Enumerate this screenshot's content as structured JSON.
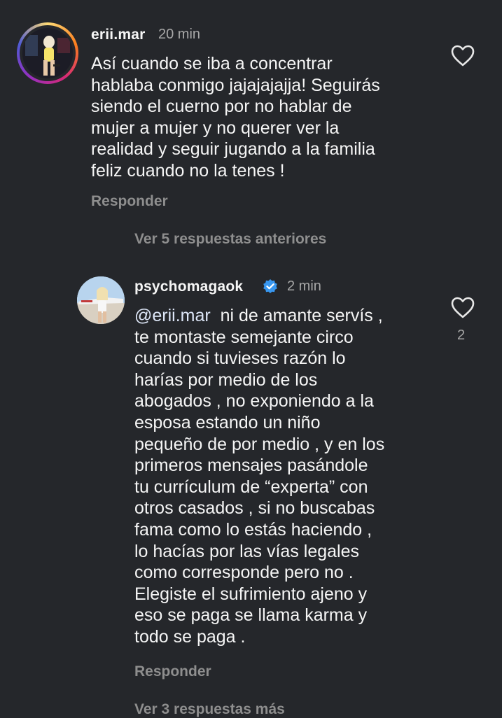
{
  "comment1": {
    "username": "erii.mar",
    "time": "20 min",
    "text": "Así cuando se iba a concentrar\nhablaba conmigo jajajajajja! Seguirás\nsiendo el cuerno por no hablar de\nmujer a mujer y no querer ver la\nrealidad y seguir jugando a la familia\nfeliz cuando no la tenes !",
    "reply_label": "Responder",
    "like_icon": "heart-outline-icon"
  },
  "view_previous_label": "Ver 5 respuestas anteriores",
  "comment2": {
    "username": "psychomagaok",
    "verified_icon": "verified-badge-icon",
    "time": "2 min",
    "mention": "@erii.mar",
    "text": "ni de amante servís ,\nte montaste semejante circo\ncuando si tuvieses razón lo\nharías por medio de los\nabogados , no exponiendo a la\nesposa estando un niño\npequeño de por medio , y en los\nprimeros mensajes pasándole\ntu currículum de “experta” con\notros casados , si no buscabas\nfama como lo estás haciendo ,\nlo hacías por las vías legales\ncomo corresponde pero no .\nElegiste el sufrimiento ajeno y\neso se paga se llama karma y\ntodo se paga .",
    "like_count": "2",
    "reply_label": "Responder",
    "like_icon": "heart-outline-icon"
  },
  "view_more_label": "Ver 3 respuestas más",
  "colors": {
    "background": "#25272b",
    "text_primary": "#f5f5f5",
    "text_secondary": "#8e8e8e",
    "verified": "#3897f0"
  }
}
